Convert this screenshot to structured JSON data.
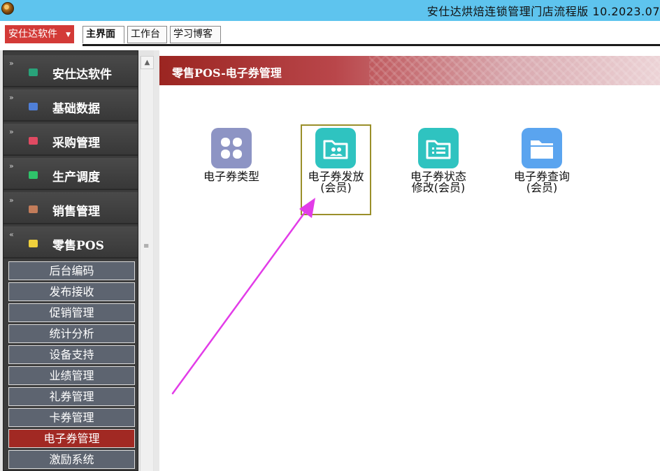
{
  "window": {
    "title": "安仕达烘焙连锁管理门店流程版   10.2023.07"
  },
  "menubar": {
    "brand_label": "安仕达软件",
    "tabs": [
      {
        "label": "主界面",
        "active": true
      },
      {
        "label": "工作台",
        "active": false
      },
      {
        "label": "学习博客",
        "active": false
      }
    ]
  },
  "sidebar": {
    "nav_items": [
      {
        "label": "安仕达软件",
        "icon": "teal-square-icon",
        "icon_color": "#29a37a"
      },
      {
        "label": "基础数据",
        "icon": "blue-square-icon",
        "icon_color": "#4f7fd8"
      },
      {
        "label": "采购管理",
        "icon": "red-square-icon",
        "icon_color": "#e04a62"
      },
      {
        "label": "生产调度",
        "icon": "green-square-icon",
        "icon_color": "#2fc36a"
      },
      {
        "label": "销售管理",
        "icon": "brown-square-icon",
        "icon_color": "#c27c5a"
      },
      {
        "label": "零售POS",
        "icon": "yellow-square-icon",
        "icon_color": "#efd03c"
      }
    ],
    "sub_items": [
      {
        "label": "后台编码",
        "active": false
      },
      {
        "label": "发布接收",
        "active": false
      },
      {
        "label": "促销管理",
        "active": false
      },
      {
        "label": "统计分析",
        "active": false
      },
      {
        "label": "设备支持",
        "active": false
      },
      {
        "label": "业绩管理",
        "active": false
      },
      {
        "label": "礼券管理",
        "active": false
      },
      {
        "label": "卡券管理",
        "active": false
      },
      {
        "label": "电子券管理",
        "active": true
      },
      {
        "label": "激励系统",
        "active": false
      }
    ]
  },
  "content": {
    "title": "零售POS-电子券管理",
    "tiles": [
      {
        "line1": "电子券类型",
        "line2": "",
        "icon": "clover-grid-icon",
        "color": "#8d94c4",
        "selected": false
      },
      {
        "line1": "电子券发放",
        "line2": "(会员)",
        "icon": "folder-users-icon",
        "color": "#2fc3c0",
        "selected": true
      },
      {
        "line1": "电子券状态",
        "line2": "修改(会员)",
        "icon": "folder-list-icon",
        "color": "#2fc3c0",
        "selected": false
      },
      {
        "line1": "电子券查询",
        "line2": "(会员)",
        "icon": "folder-icon",
        "color": "#5aa4ef",
        "selected": false
      }
    ]
  },
  "annotation": {
    "arrow_color": "#e23ce8"
  }
}
